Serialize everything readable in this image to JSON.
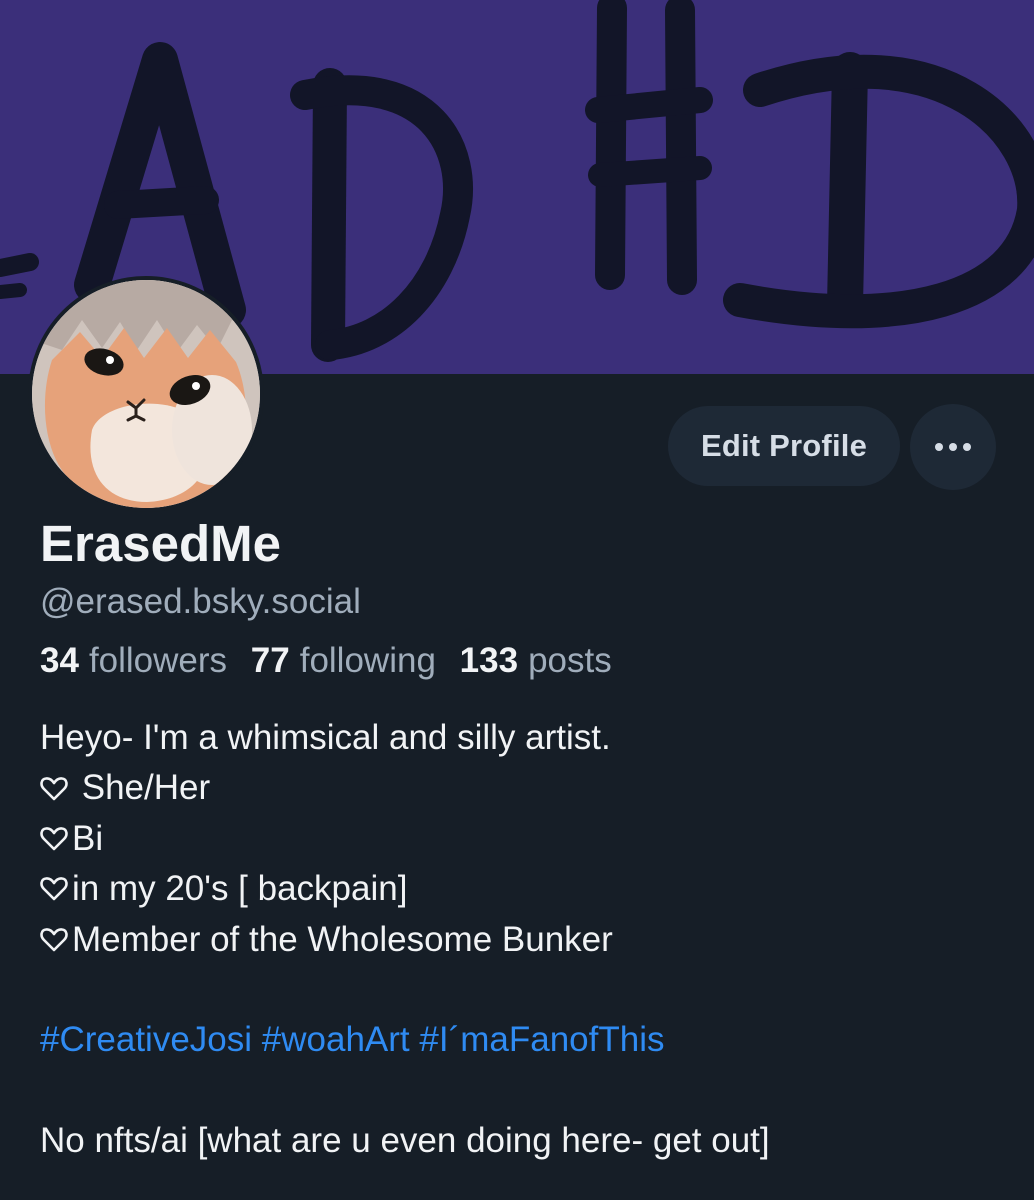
{
  "banner": {
    "text": "ADHD",
    "bg_color": "#3b2f7a",
    "ink_color": "#121528"
  },
  "avatar": {
    "description_icon": "cat-avatar"
  },
  "actions": {
    "edit_profile_label": "Edit Profile",
    "more_icon": "ellipsis-icon"
  },
  "profile": {
    "display_name": "ErasedMe",
    "handle": "@erased.bsky.social"
  },
  "stats": {
    "followers_count": "34",
    "followers_label": "followers",
    "following_count": "77",
    "following_label": "following",
    "posts_count": "133",
    "posts_label": "posts"
  },
  "bio": {
    "line1": "Heyo- I'm a whimsical and silly artist.",
    "line2": " She/Her",
    "line3": "Bi",
    "line4": "in my 20's [ backpain]",
    "line5": "Member of the Wholesome Bunker",
    "tags": [
      "#CreativeJosi",
      "#woahArt",
      "#I´maFanofThis"
    ],
    "line_last": "No nfts/ai [what are u even doing here- get out]",
    "heart_icon": "heart-outline-icon",
    "link_color": "#2f8bf2"
  }
}
